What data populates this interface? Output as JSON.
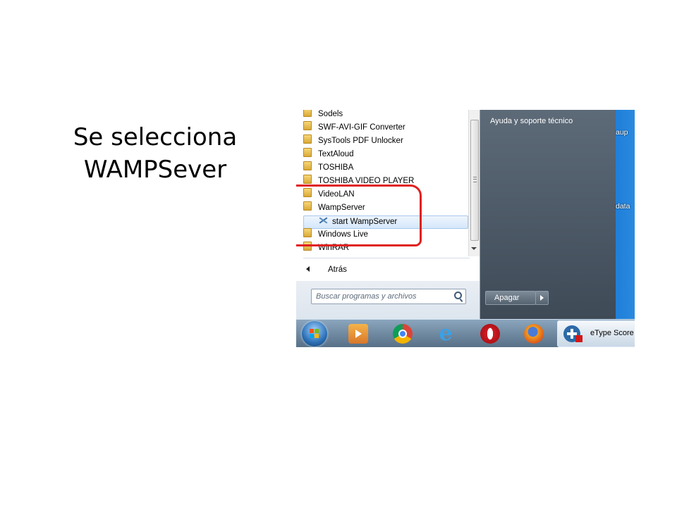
{
  "slide": {
    "title_line1": "Se selecciona",
    "title_line2": "WAMPSever"
  },
  "start_menu": {
    "programs": [
      {
        "label": "Sodels",
        "type": "folder"
      },
      {
        "label": "SWF-AVI-GIF Converter",
        "type": "folder"
      },
      {
        "label": "SysTools PDF Unlocker",
        "type": "folder"
      },
      {
        "label": "TextAloud",
        "type": "folder"
      },
      {
        "label": "TOSHIBA",
        "type": "folder"
      },
      {
        "label": "TOSHIBA VIDEO PLAYER",
        "type": "folder"
      },
      {
        "label": "VideoLAN",
        "type": "folder"
      },
      {
        "label": "WampServer",
        "type": "folder"
      },
      {
        "label": "start WampServer",
        "type": "shortcut",
        "selected": true
      },
      {
        "label": "Windows Live",
        "type": "folder"
      },
      {
        "label": "WinRAR",
        "type": "folder"
      }
    ],
    "back_label": "Atrás",
    "search_placeholder": "Buscar programas y archivos",
    "right_link": "Ayuda y soporte técnico",
    "shutdown_label": "Apagar"
  },
  "desktop": {
    "labels": [
      "aup",
      "data"
    ]
  },
  "taskbar": {
    "icons": [
      "windows-start-orb",
      "media-player-icon",
      "chrome-icon",
      "internet-explorer-icon",
      "opera-icon",
      "firefox-icon"
    ],
    "etype_label": "eType Score"
  },
  "colors": {
    "highlight": "#e02020",
    "desktop_blue": "#2a8ae0",
    "menu_right_panel": "#4e5b68"
  }
}
